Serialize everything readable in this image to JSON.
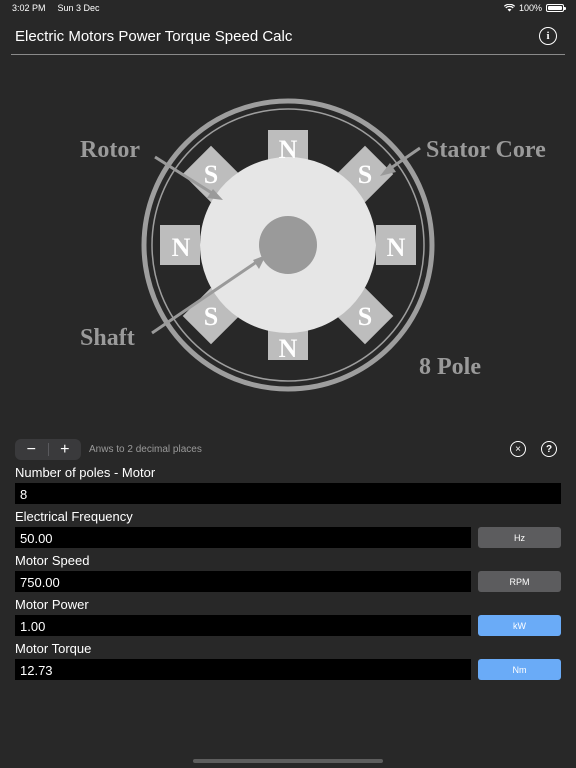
{
  "status": {
    "time": "3:02 PM",
    "date": "Sun 3 Dec",
    "battery": "100%",
    "battery_level": 1.0
  },
  "header": {
    "title": "Electric Motors Power Torque Speed Calc"
  },
  "diagram": {
    "labels": {
      "rotor": "Rotor",
      "stator": "Stator Core",
      "shaft": "Shaft",
      "poles": "8 Pole"
    },
    "pole_letters": {
      "n": "N",
      "s": "S"
    }
  },
  "controls": {
    "minus": "−",
    "plus": "+",
    "decimals_label": "Anws to 2 decimal places",
    "clear_icon": "×",
    "help_icon": "?"
  },
  "fields": {
    "poles": {
      "label": "Number of poles - Motor",
      "value": "8"
    },
    "frequency": {
      "label": "Electrical Frequency",
      "value": "50.00",
      "unit": "Hz"
    },
    "speed": {
      "label": "Motor Speed",
      "value": "750.00",
      "unit": "RPM"
    },
    "power": {
      "label": "Motor Power",
      "value": "1.00",
      "unit": "kW"
    },
    "torque": {
      "label": "Motor Torque",
      "value": "12.73",
      "unit": "Nm"
    }
  },
  "colors": {
    "background": "#282828",
    "unit_gray": "#5c5c5e",
    "unit_blue": "#6aabf7"
  }
}
